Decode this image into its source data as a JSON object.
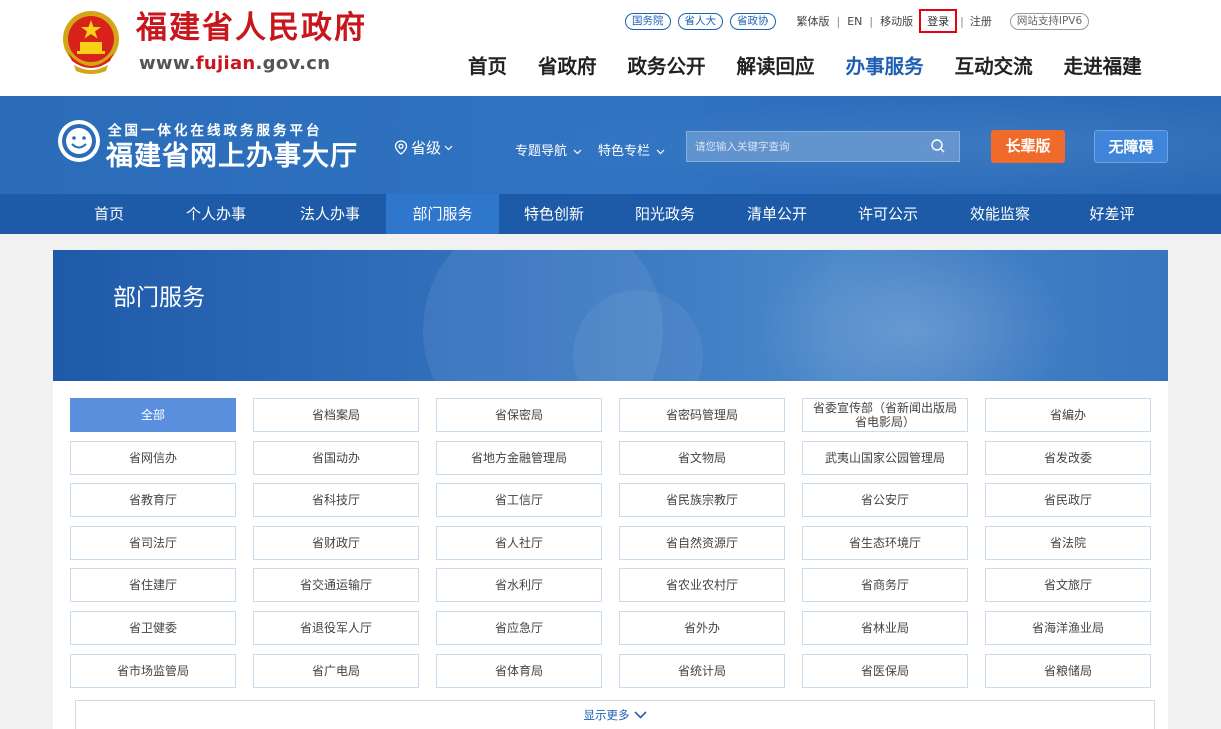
{
  "header": {
    "site_name": "福建省人民政府",
    "site_url_prefix": "www.",
    "site_url_domain": "fujian",
    "site_url_suffix": ".gov.cn",
    "pills": [
      "国务院",
      "省人大",
      "省政协"
    ],
    "links": [
      "繁体版",
      "EN",
      "移动版"
    ],
    "login": "登录",
    "register": "注册",
    "ipv6": "网站支持IPV6",
    "nav": [
      "首页",
      "省政府",
      "政务公开",
      "解读回应",
      "办事服务",
      "互动交流",
      "走进福建"
    ],
    "nav_active_index": 4
  },
  "platform": {
    "subtitle": "全国一体化在线政务服务平台",
    "title": "福建省网上办事大厅",
    "level": "省级",
    "menu1": "专题导航",
    "menu2": "特色专栏",
    "search_placeholder": "请您输入关键字查询",
    "elder_btn": "长辈版",
    "access_btn": "无障碍"
  },
  "subnav": {
    "items": [
      "首页",
      "个人办事",
      "法人办事",
      "部门服务",
      "特色创新",
      "阳光政务",
      "清单公开",
      "许可公示",
      "效能监察",
      "好差评"
    ],
    "active_index": 3
  },
  "content": {
    "banner_title": "部门服务",
    "departments": [
      "全部",
      "省档案局",
      "省保密局",
      "省密码管理局",
      "省委宣传部（省新闻出版局 省电影局）",
      "省编办",
      "省网信办",
      "省国动办",
      "省地方金融管理局",
      "省文物局",
      "武夷山国家公园管理局",
      "省发改委",
      "省教育厅",
      "省科技厅",
      "省工信厅",
      "省民族宗教厅",
      "省公安厅",
      "省民政厅",
      "省司法厅",
      "省财政厅",
      "省人社厅",
      "省自然资源厅",
      "省生态环境厅",
      "省法院",
      "省住建厅",
      "省交通运输厅",
      "省水利厅",
      "省农业农村厅",
      "省商务厅",
      "省文旅厅",
      "省卫健委",
      "省退役军人厅",
      "省应急厅",
      "省外办",
      "省林业局",
      "省海洋渔业局",
      "省市场监管局",
      "省广电局",
      "省体育局",
      "省统计局",
      "省医保局",
      "省粮储局"
    ],
    "active_department_index": 0,
    "show_more": "显示更多"
  },
  "colors": {
    "brand_red": "#c8161d",
    "brand_blue": "#1e5fb3",
    "subnav_bg": "#1d5aa7",
    "elder_orange": "#f06a2b",
    "active_cell": "#5a8fdd"
  }
}
